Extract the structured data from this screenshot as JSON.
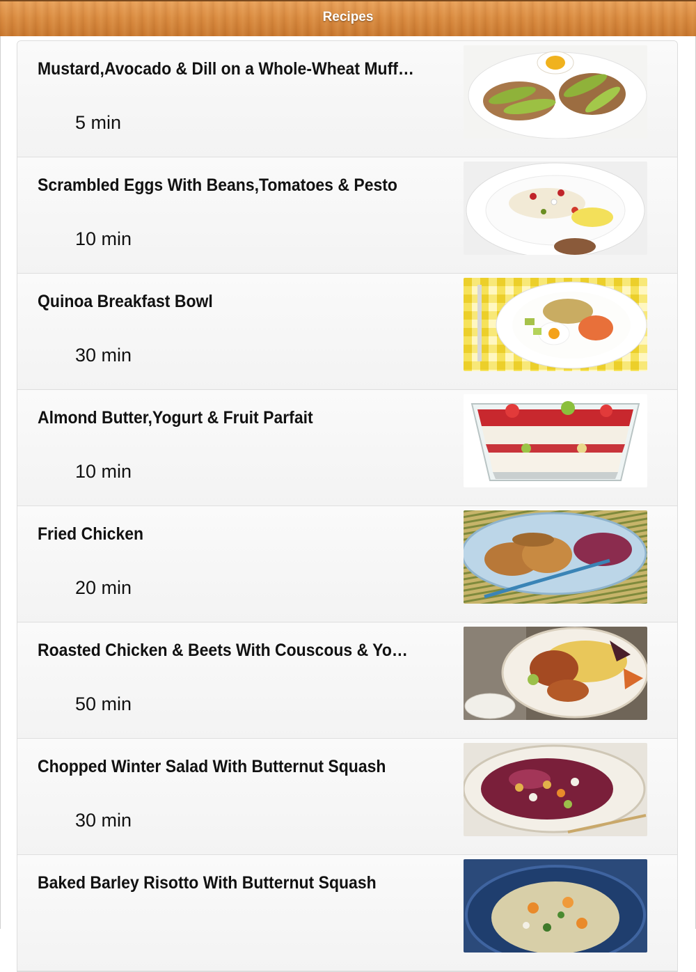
{
  "header": {
    "title": "Recipes"
  },
  "recipes": [
    {
      "title": "Mustard,Avocado & Dill on a Whole-Wheat Muffi…",
      "time": "5 min"
    },
    {
      "title": "Scrambled Eggs With Beans,Tomatoes & Pesto",
      "time": "10 min"
    },
    {
      "title": "Quinoa Breakfast Bowl",
      "time": "30 min"
    },
    {
      "title": "Almond Butter,Yogurt & Fruit Parfait",
      "time": "10 min"
    },
    {
      "title": "Fried Chicken",
      "time": "20 min"
    },
    {
      "title": "Roasted Chicken & Beets With Couscous & Youg…",
      "time": "50 min"
    },
    {
      "title": "Chopped Winter Salad With Butternut Squash",
      "time": "30 min"
    },
    {
      "title": "Baked Barley Risotto With Butternut Squash",
      "time": ""
    }
  ],
  "images": [
    "avocado-toast-photo",
    "scrambled-eggs-beans-photo",
    "quinoa-bowl-photo",
    "yogurt-parfait-photo",
    "fried-chicken-photo",
    "roasted-chicken-couscous-photo",
    "winter-salad-photo",
    "barley-risotto-photo"
  ],
  "colors": {
    "header_wood": "#d98a3f",
    "row_bg": "#f6f6f6",
    "text": "#111111"
  }
}
